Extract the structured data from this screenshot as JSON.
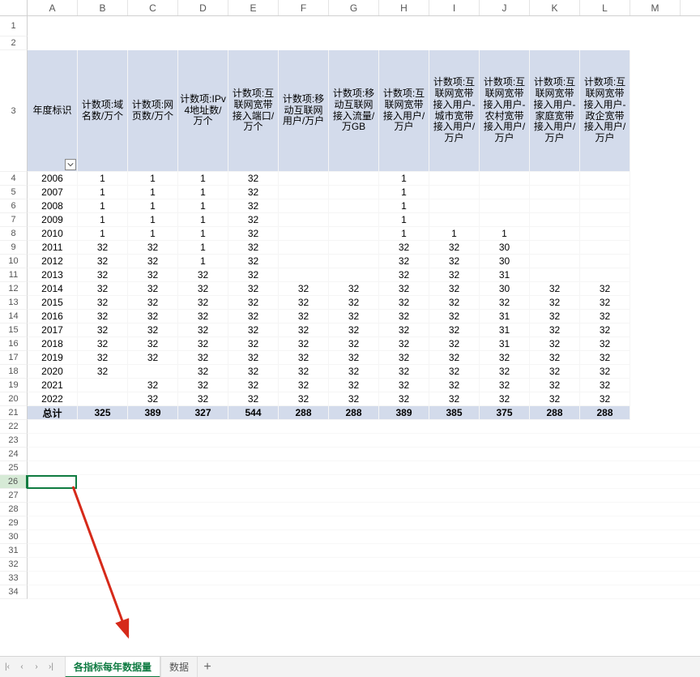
{
  "columns": [
    "A",
    "B",
    "C",
    "D",
    "E",
    "F",
    "G",
    "H",
    "I",
    "J",
    "K",
    "L",
    "M"
  ],
  "row_numbers_top": [
    "1",
    "2"
  ],
  "header_row_number": "3",
  "row_numbers_data": [
    "4",
    "5",
    "6",
    "7",
    "8",
    "9",
    "10",
    "11",
    "12",
    "13",
    "14",
    "15",
    "16",
    "17",
    "18",
    "19",
    "20",
    "21"
  ],
  "row_numbers_empty": [
    "22",
    "23",
    "24",
    "25",
    "26",
    "27",
    "28",
    "29",
    "30",
    "31",
    "32",
    "33",
    "34"
  ],
  "selected_row": "26",
  "headers": {
    "A": "年度标识",
    "B": "计数项:域名数/万个",
    "C": "计数项:网页数/万个",
    "D": "计数项:IPv4地址数/万个",
    "E": "计数项:互联网宽带接入端口/万个",
    "F": "计数项:移动互联网用户/万户",
    "G": "计数项:移动互联网接入流量/万GB",
    "H": "计数项:互联网宽带接入用户/万户",
    "I": "计数项:互联网宽带接入用户-城市宽带接入用户/万户",
    "J": "计数项:互联网宽带接入用户-农村宽带接入用户/万户",
    "K": "计数项:互联网宽带接入用户-家庭宽带接入用户/万户",
    "L": "计数项:互联网宽带接入用户-政企宽带接入用户/万户"
  },
  "rows": [
    {
      "A": "2006",
      "B": "1",
      "C": "1",
      "D": "1",
      "E": "32",
      "F": "",
      "G": "",
      "H": "1",
      "I": "",
      "J": "",
      "K": "",
      "L": ""
    },
    {
      "A": "2007",
      "B": "1",
      "C": "1",
      "D": "1",
      "E": "32",
      "F": "",
      "G": "",
      "H": "1",
      "I": "",
      "J": "",
      "K": "",
      "L": ""
    },
    {
      "A": "2008",
      "B": "1",
      "C": "1",
      "D": "1",
      "E": "32",
      "F": "",
      "G": "",
      "H": "1",
      "I": "",
      "J": "",
      "K": "",
      "L": ""
    },
    {
      "A": "2009",
      "B": "1",
      "C": "1",
      "D": "1",
      "E": "32",
      "F": "",
      "G": "",
      "H": "1",
      "I": "",
      "J": "",
      "K": "",
      "L": ""
    },
    {
      "A": "2010",
      "B": "1",
      "C": "1",
      "D": "1",
      "E": "32",
      "F": "",
      "G": "",
      "H": "1",
      "I": "1",
      "J": "1",
      "K": "",
      "L": ""
    },
    {
      "A": "2011",
      "B": "32",
      "C": "32",
      "D": "1",
      "E": "32",
      "F": "",
      "G": "",
      "H": "32",
      "I": "32",
      "J": "30",
      "K": "",
      "L": ""
    },
    {
      "A": "2012",
      "B": "32",
      "C": "32",
      "D": "1",
      "E": "32",
      "F": "",
      "G": "",
      "H": "32",
      "I": "32",
      "J": "30",
      "K": "",
      "L": ""
    },
    {
      "A": "2013",
      "B": "32",
      "C": "32",
      "D": "32",
      "E": "32",
      "F": "",
      "G": "",
      "H": "32",
      "I": "32",
      "J": "31",
      "K": "",
      "L": ""
    },
    {
      "A": "2014",
      "B": "32",
      "C": "32",
      "D": "32",
      "E": "32",
      "F": "32",
      "G": "32",
      "H": "32",
      "I": "32",
      "J": "30",
      "K": "32",
      "L": "32"
    },
    {
      "A": "2015",
      "B": "32",
      "C": "32",
      "D": "32",
      "E": "32",
      "F": "32",
      "G": "32",
      "H": "32",
      "I": "32",
      "J": "32",
      "K": "32",
      "L": "32"
    },
    {
      "A": "2016",
      "B": "32",
      "C": "32",
      "D": "32",
      "E": "32",
      "F": "32",
      "G": "32",
      "H": "32",
      "I": "32",
      "J": "31",
      "K": "32",
      "L": "32"
    },
    {
      "A": "2017",
      "B": "32",
      "C": "32",
      "D": "32",
      "E": "32",
      "F": "32",
      "G": "32",
      "H": "32",
      "I": "32",
      "J": "31",
      "K": "32",
      "L": "32"
    },
    {
      "A": "2018",
      "B": "32",
      "C": "32",
      "D": "32",
      "E": "32",
      "F": "32",
      "G": "32",
      "H": "32",
      "I": "32",
      "J": "31",
      "K": "32",
      "L": "32"
    },
    {
      "A": "2019",
      "B": "32",
      "C": "32",
      "D": "32",
      "E": "32",
      "F": "32",
      "G": "32",
      "H": "32",
      "I": "32",
      "J": "32",
      "K": "32",
      "L": "32"
    },
    {
      "A": "2020",
      "B": "32",
      "C": "",
      "D": "32",
      "E": "32",
      "F": "32",
      "G": "32",
      "H": "32",
      "I": "32",
      "J": "32",
      "K": "32",
      "L": "32"
    },
    {
      "A": "2021",
      "B": "",
      "C": "32",
      "D": "32",
      "E": "32",
      "F": "32",
      "G": "32",
      "H": "32",
      "I": "32",
      "J": "32",
      "K": "32",
      "L": "32"
    },
    {
      "A": "2022",
      "B": "",
      "C": "32",
      "D": "32",
      "E": "32",
      "F": "32",
      "G": "32",
      "H": "32",
      "I": "32",
      "J": "32",
      "K": "32",
      "L": "32"
    }
  ],
  "total": {
    "A": "总计",
    "B": "325",
    "C": "389",
    "D": "327",
    "E": "544",
    "F": "288",
    "G": "288",
    "H": "389",
    "I": "385",
    "J": "375",
    "K": "288",
    "L": "288"
  },
  "tabs": {
    "active": "各指标每年数据量",
    "inactive": "数据"
  },
  "nav": {
    "first": "|‹",
    "prev": "‹",
    "next": "›",
    "last": "›|",
    "add": "+"
  }
}
